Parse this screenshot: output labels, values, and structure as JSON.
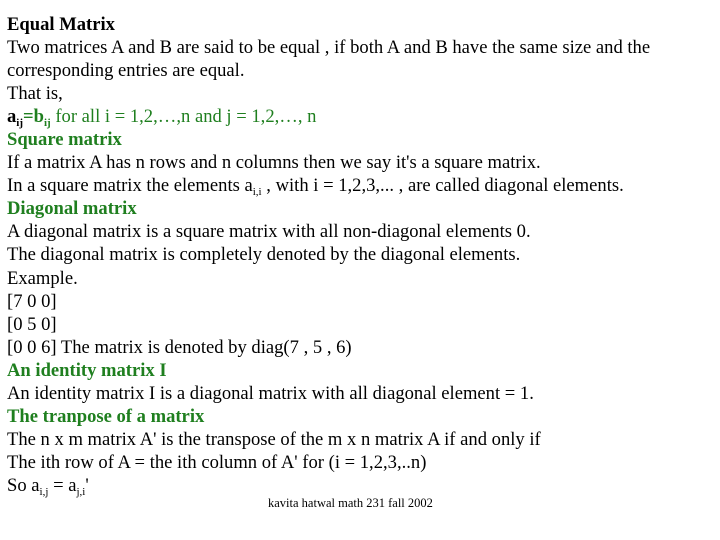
{
  "sections": {
    "equal_matrix": {
      "heading": "Equal Matrix",
      "line1": "Two matrices A and B are said to be equal , if both A and B have the same size and the",
      "line2": "corresponding entries are equal.",
      "line3": "That is,",
      "formula": {
        "a": "a",
        "a_sub": "ij",
        "eq_b": "=b",
        "b_sub": "ij",
        "rest": " for all i = 1,2,…,n and j = 1,2,…, n"
      }
    },
    "square_matrix": {
      "heading": "Square matrix",
      "line1": "If a matrix A has n rows and n columns then we say it's a square matrix.",
      "line2_pre": "In a square matrix the elements a",
      "line2_sub": "i,i",
      "line2_post": " , with i = 1,2,3,... , are called diagonal elements."
    },
    "diagonal_matrix": {
      "heading": "Diagonal matrix",
      "line1": "A diagonal matrix is a square matrix with all non-diagonal elements 0.",
      "line2": "The diagonal matrix is completely denoted by the diagonal elements.",
      "line3": "Example.",
      "rows": [
        "[7 0 0]",
        "[0 5 0]",
        "[0 0 6] The matrix is denoted by diag(7 , 5 , 6)"
      ]
    },
    "identity_matrix": {
      "heading": "An identity matrix I",
      "line1": "An identity matrix I is a diagonal matrix with all diagonal element = 1."
    },
    "transpose": {
      "heading": "The tranpose of a matrix",
      "line1": "The n x m matrix A' is the transpose of the m x n matrix A if and only if",
      "line2": "The ith row of A = the ith column of A' for (i = 1,2,3,..n)",
      "line3": {
        "pre": "So a",
        "sub1": "i,j",
        "mid": " = a",
        "sub2": "j,i",
        "post": "'"
      }
    }
  },
  "footer": "kavita hatwal math 231 fall 2002",
  "colors": {
    "heading_green": "#1f7f1f",
    "text": "#000000",
    "background": "#ffffff"
  }
}
